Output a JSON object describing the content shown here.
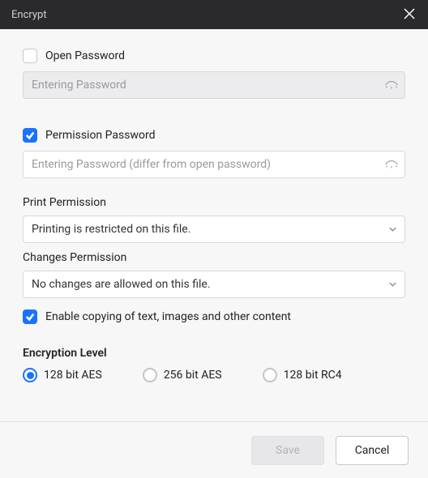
{
  "titlebar": {
    "title": "Encrypt"
  },
  "open_password": {
    "label": "Open Password",
    "checked": false,
    "placeholder": "Entering Password",
    "value": ""
  },
  "permission_password": {
    "label": "Permission Password",
    "checked": true,
    "placeholder": "Entering Password (differ from open password)",
    "value": ""
  },
  "print_permission": {
    "label": "Print Permission",
    "value": "Printing is restricted on this file."
  },
  "changes_permission": {
    "label": "Changes Permission",
    "value": "No changes are allowed on this file."
  },
  "enable_copy": {
    "label": "Enable copying of text, images and other content",
    "checked": true
  },
  "encryption_level": {
    "label": "Encryption Level",
    "options": [
      "128 bit AES",
      "256 bit AES",
      "128 bit RC4"
    ],
    "selected": "128 bit AES"
  },
  "footer": {
    "save": "Save",
    "cancel": "Cancel"
  }
}
